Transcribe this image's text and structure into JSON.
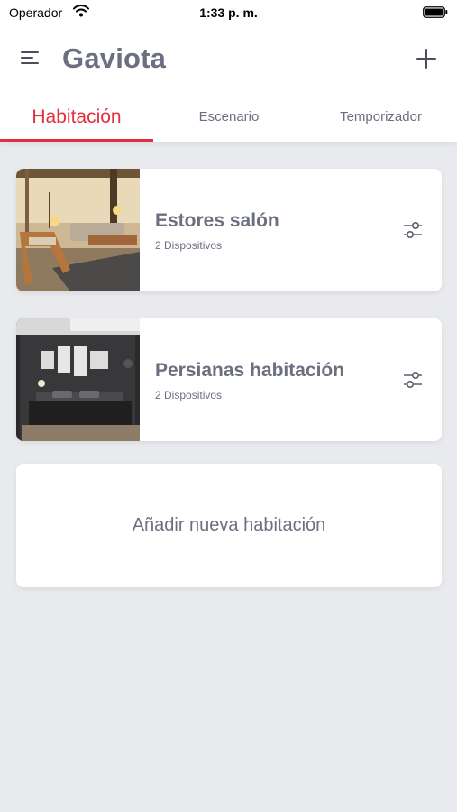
{
  "status_bar": {
    "carrier": "Operador",
    "time": "1:33 p. m."
  },
  "header": {
    "title": "Gaviota",
    "menu_icon": "hamburger-menu-icon",
    "add_icon": "plus-icon"
  },
  "tabs": [
    {
      "label": "Habitación",
      "active": true
    },
    {
      "label": "Escenario",
      "active": false
    },
    {
      "label": "Temporizador",
      "active": false
    }
  ],
  "rooms": [
    {
      "name": "Estores salón",
      "devices": "2 Dispositivos",
      "image": "living-room-photo",
      "action_icon": "sliders-icon"
    },
    {
      "name": "Persianas habitación",
      "devices": "2 Dispositivos",
      "image": "bedroom-photo",
      "action_icon": "sliders-icon"
    }
  ],
  "add_room": {
    "label": "Añadir nueva habitación"
  },
  "colors": {
    "accent": "#e2303f",
    "text": "#6b6f80",
    "background": "#e9eaee",
    "card": "#ffffff"
  }
}
